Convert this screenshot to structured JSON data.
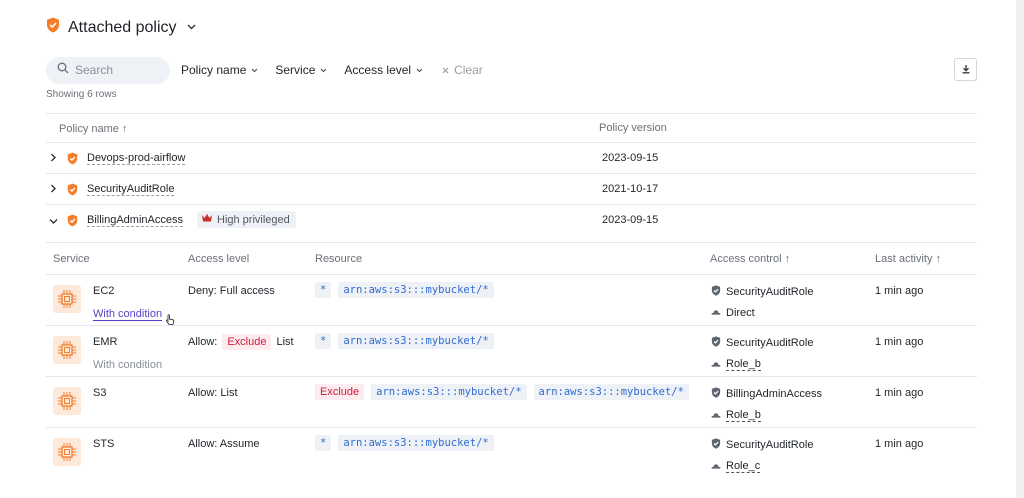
{
  "header": {
    "title": "Attached policy",
    "icon": "shield-icon",
    "brand_color": "#f47d29"
  },
  "toolbar": {
    "search_placeholder": "Search",
    "filters": [
      "Policy name",
      "Service",
      "Access level"
    ],
    "clear_label": "Clear"
  },
  "showing": "Showing 6 rows",
  "policy_table": {
    "headers": {
      "name": "Policy name ↑",
      "version": "Policy version"
    },
    "rows": [
      {
        "name": "Devops-prod-airflow",
        "version": "2023-09-15",
        "expanded": false
      },
      {
        "name": "SecurityAuditRole",
        "version": "2021-10-17",
        "expanded": false
      },
      {
        "name": "BillingAdminAccess",
        "version": "2023-09-15",
        "expanded": true,
        "badge": "High privileged"
      }
    ]
  },
  "detail_table": {
    "headers": {
      "service": "Service",
      "access": "Access level",
      "resource": "Resource",
      "access_control": "Access control ↑",
      "last_activity": "Last activity ↑"
    },
    "rows": [
      {
        "service": "EC2",
        "condition": "With condition",
        "access_prefix": "Deny: Full access",
        "access_exclude": "",
        "access_suffix": "",
        "res1": "*",
        "res2": "arn:aws:s3:::mybucket/*",
        "ac_role": "SecurityAuditRole",
        "ac_sub": "Direct",
        "last": "1 min ago"
      },
      {
        "service": "EMR",
        "condition": "With condition",
        "access_prefix": "Allow:",
        "access_exclude": "Exclude",
        "access_suffix": "List",
        "res1": "*",
        "res2": "arn:aws:s3:::mybucket/*",
        "ac_role": "SecurityAuditRole",
        "ac_sub": "Role_b",
        "last": "1 min ago"
      },
      {
        "service": "S3",
        "condition": "",
        "access_prefix": "Allow: List",
        "access_exclude": "",
        "access_suffix": "",
        "res_exclude": "Exclude",
        "res1": "arn:aws:s3:::mybucket/*",
        "res2": "arn:aws:s3:::mybucket/*",
        "ac_role": "BillingAdminAccess",
        "ac_sub": "Role_b",
        "last": "1 min ago"
      },
      {
        "service": "STS",
        "condition": "",
        "access_prefix": "Allow: Assume",
        "access_exclude": "",
        "access_suffix": "",
        "res1": "*",
        "res2": "arn:aws:s3:::mybucket/*",
        "ac_role": "SecurityAuditRole",
        "ac_sub": "Role_c",
        "last": "1 min ago"
      }
    ]
  }
}
